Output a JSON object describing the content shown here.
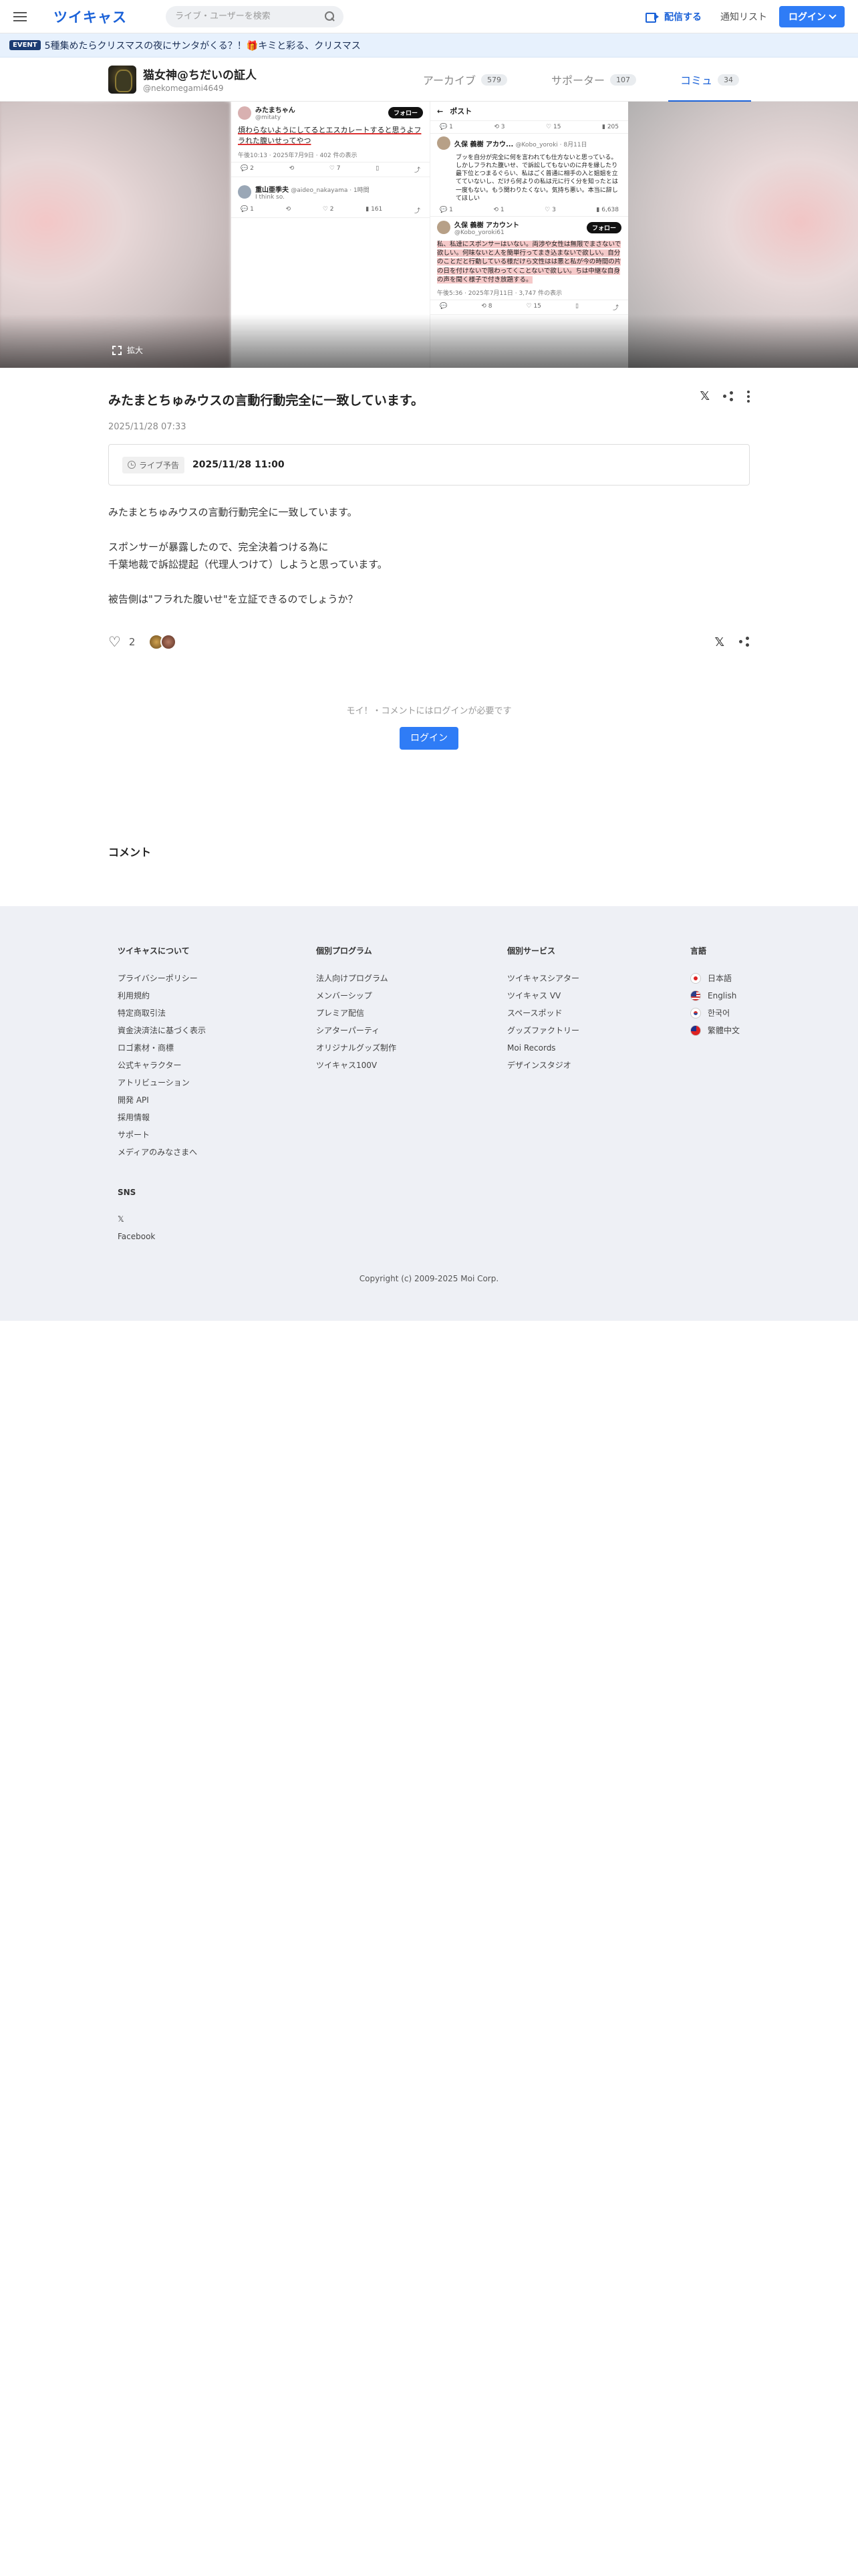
{
  "header": {
    "logo": "ツイキャス",
    "search_placeholder": "ライブ・ユーザーを検索",
    "broadcast_label": "配信する",
    "notification_label": "通知リスト",
    "login_label": "ログイン"
  },
  "event": {
    "badge": "EVENT",
    "text": "5種集めたらクリスマスの夜にサンタがくる？！🎁キミと彩る、クリスマス"
  },
  "profile": {
    "name": "猫女神@ちだいの証人",
    "handle": "@nekomegami4649"
  },
  "tabs": [
    {
      "label": "アーカイブ",
      "count": "579"
    },
    {
      "label": "サポーター",
      "count": "107"
    },
    {
      "label": "コミュ",
      "count": "34"
    }
  ],
  "hero": {
    "expand_label": "拡大",
    "left_tweet": {
      "name": "みたまちゃん",
      "handle": "@mitaty",
      "follow": "フォロー",
      "body": "煩わらないようにしてるとエスカレートすると思うよフラれた腹いせってやつ",
      "meta": "午後10:13 · 2025年7月9日 · 402 件の表示",
      "counts": [
        "2",
        "",
        "7",
        ""
      ],
      "reply_name": "重山亜季夫",
      "reply_handle": "@aideo_nakayama · 1時間",
      "reply_body": "I think so.",
      "reply_counts": [
        "1",
        "",
        "2",
        "161"
      ]
    },
    "right_tweet": {
      "post_label": "ポスト",
      "top_counts": [
        "1",
        "3",
        "15",
        "205"
      ],
      "name1": "久保 義樹 アカウ...",
      "handle1": "@Kobo_yoroki · 8月11日",
      "body1": "ブッを自分が完全に何を言われても仕方ないと思っている。しかしフラれた腹いせ、で訴訟してもないのに弁を縁したり最下位とつまるぐらい、私はごく普通に相手の入と姐姐を立てていないし、だけら何よりの私は元に行く分を知ったとは一度もない。もう関わりたくない。気持ち悪い。本当に辞してほしい",
      "counts1": [
        "1",
        "1",
        "3",
        "6,638"
      ],
      "name2": "久保 義樹 アカウント",
      "handle2": "@Kobo_yoroki61",
      "follow2": "フォロー",
      "body2": "私、私達にスポンサーはいない。両渉や女性は無限でまさないで欲しい。何味ないと人を簡単行ってまき込まないで欲しい。自分のことだと行動している様だけら文性はは悪と私が今の時間の片の日を付けないで限わってくことないで欲しい。ちは中継な自身の声を聞く様子で付き放題する。",
      "meta2": "午後5:36 · 2025年7月11日 · 3,747 件の表示",
      "counts2": [
        "",
        "8",
        "15",
        ""
      ]
    }
  },
  "article": {
    "title": "みたまとちゅみウスの言動行動完全に一致しています。",
    "date": "2025/11/28 07:33",
    "live_tag": "ライブ予告",
    "live_date": "2025/11/28 11:00",
    "body": [
      "みたまとちゅみウスの言動行動完全に一致しています。",
      "",
      "スポンサーが暴露したので、完全決着つける為に",
      "千葉地裁で訴訟提起（代理人つけて）しようと思っています。",
      "",
      "被告側は\"フラれた腹いせ\"を立証できるのでしょうか？"
    ],
    "like_count": "2",
    "login_note": "モイ！・コメントにはログインが必要です",
    "login_button": "ログイン",
    "comments_title": "コメント"
  },
  "footer": {
    "col1": {
      "title": "ツイキャスについて",
      "links": [
        "プライバシーポリシー",
        "利用規約",
        "特定商取引法",
        "資金決済法に基づく表示",
        "ロゴ素材・商標",
        "公式キャラクター",
        "アトリビューション",
        "開発 API",
        "採用情報",
        "サポート",
        "メディアのみなさまへ"
      ]
    },
    "sns": {
      "title": "SNS",
      "links": [
        "𝕏",
        "Facebook"
      ]
    },
    "col2": {
      "title": "個別プログラム",
      "links": [
        "法人向けプログラム",
        "メンバーシップ",
        "プレミア配信",
        "シアターパーティ",
        "オリジナルグッズ制作",
        "ツイキャス100V"
      ]
    },
    "col3": {
      "title": "個別サービス",
      "links": [
        "ツイキャスシアター",
        "ツイキャス VV",
        "スペースポッド",
        "グッズファクトリー",
        "Moi Records",
        "デザインスタジオ"
      ]
    },
    "col4": {
      "title": "言語",
      "langs": [
        {
          "flag": "jp",
          "label": "日本語"
        },
        {
          "flag": "us",
          "label": "English"
        },
        {
          "flag": "kr",
          "label": "한국어"
        },
        {
          "flag": "tw",
          "label": "繁體中文"
        }
      ]
    },
    "copyright": "Copyright (c) 2009-2025 Moi Corp."
  }
}
